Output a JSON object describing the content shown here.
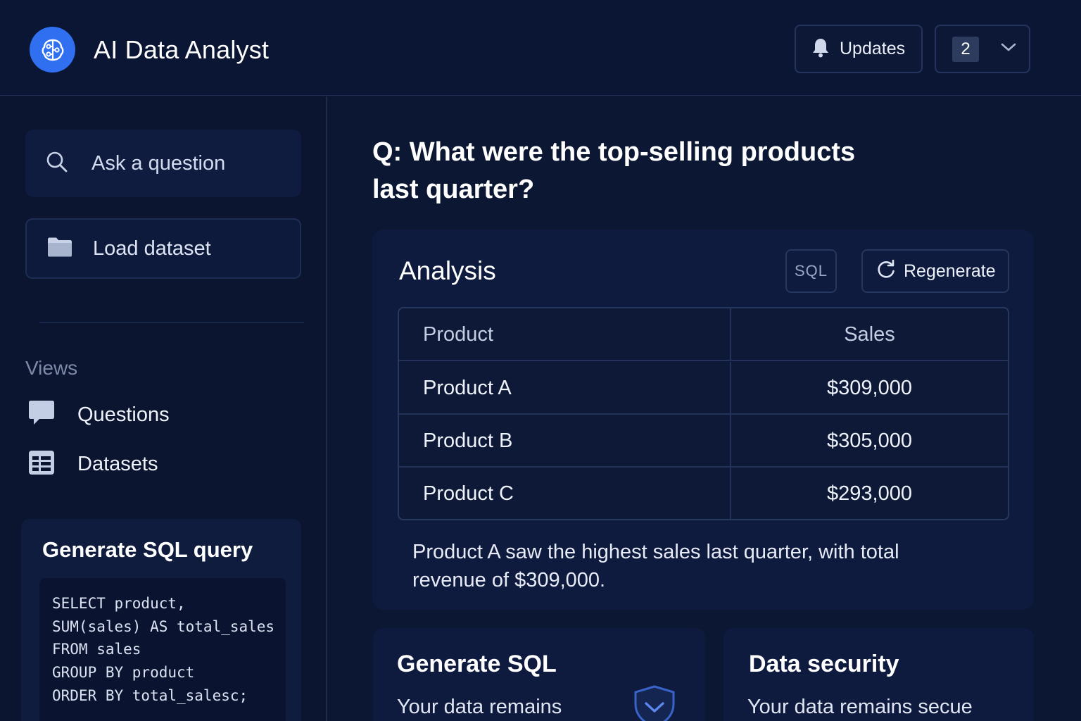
{
  "header": {
    "app_title": "AI Data Analyst",
    "updates_label": "Updates",
    "notification_count": "2"
  },
  "sidebar": {
    "search_placeholder": "Ask a question",
    "load_label": "Load dataset",
    "views_heading": "Views",
    "nav": [
      {
        "label": "Questions",
        "icon": "chat-bubble-icon"
      },
      {
        "label": "Datasets",
        "icon": "table-grid-icon"
      }
    ],
    "sql_card": {
      "title": "Generate SQL query",
      "code": [
        "SELECT product,",
        "SUM(sales) AS total_sales",
        "FROM sales",
        "GROUP BY product",
        "ORDER BY total_salesc;"
      ]
    }
  },
  "main": {
    "question": "Q: What were the top-selling products last quarter?",
    "analysis": {
      "title": "Analysis",
      "sql_label": "SQL",
      "regenerate_label": "Regenerate",
      "table": {
        "headers": [
          "Product",
          "Sales"
        ],
        "rows": [
          [
            "Product A",
            "$309,000"
          ],
          [
            "Product B",
            "$305,000"
          ],
          [
            "Product C",
            "$293,000"
          ]
        ]
      },
      "summary": "Product A saw the highest sales last quarter, with total revenue of $309,000."
    },
    "cards": [
      {
        "title": "Generate SQL",
        "text": "Your data remains"
      },
      {
        "title": "Data security",
        "text": "Your data remains secue"
      }
    ]
  },
  "colors": {
    "background": "#0c1733",
    "accent": "#2f6ff0",
    "card": "#0f1b3e"
  }
}
